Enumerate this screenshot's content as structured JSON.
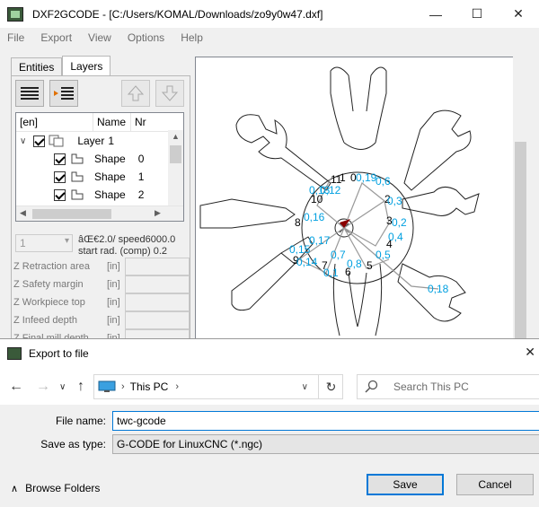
{
  "app": {
    "title": "DXF2GCODE - [C:/Users/KOMAL/Downloads/zo9y0w47.dxf]",
    "window_controls": [
      "—",
      "☐",
      "✕"
    ]
  },
  "menu": [
    "File",
    "Export",
    "View",
    "Options",
    "Help"
  ],
  "tabs": [
    "Entities",
    "Layers"
  ],
  "active_tab": "Layers",
  "tree": {
    "columns": [
      "[en]",
      "Name",
      "Nr"
    ],
    "rows": [
      {
        "name": "Layer",
        "nr": "1",
        "level": 0
      },
      {
        "name": "Shape",
        "nr": "0",
        "level": 1
      },
      {
        "name": "Shape",
        "nr": "1",
        "level": 1
      },
      {
        "name": "Shape",
        "nr": "2",
        "level": 1
      }
    ]
  },
  "tool_combo": "1",
  "speed_text_line1": "âŒ€2.0/ speed6000.0",
  "speed_text_line2": "start rad. (comp) 0.2",
  "params": [
    {
      "label": "Z Retraction area",
      "unit": "[in]"
    },
    {
      "label": "Z Safety margin",
      "unit": "[in]"
    },
    {
      "label": "Z Workpiece top",
      "unit": "[in]"
    },
    {
      "label": "Z Infeed depth",
      "unit": "[in]"
    },
    {
      "label": "Z Final mill depth",
      "unit": "[in]"
    }
  ],
  "canvas_labels": [
    "10",
    "11",
    "0",
    "1",
    "6",
    "2",
    "3",
    "4",
    "5",
    "7",
    "8",
    "9"
  ],
  "canvas_path_labels": [
    "0,6",
    "0,3",
    "0,2",
    "0,4",
    "0,5",
    "0,8",
    "0,7",
    "0,1",
    "0,17",
    "0,16",
    "0,15",
    "0,18",
    "0,13",
    "0,14",
    "0,12",
    "0,19"
  ],
  "dialog": {
    "title": "Export to file",
    "close": "✕",
    "address": [
      "This PC"
    ],
    "search_placeholder": "Search This PC",
    "file_name_label": "File name:",
    "file_name_value": "twc-gcode",
    "save_type_label": "Save as type:",
    "save_type_value": "G-CODE for LinuxCNC (*.ngc)",
    "browse_folders": "Browse Folders",
    "save": "Save",
    "cancel": "Cancel"
  },
  "colors": {
    "accent": "#0078d7",
    "path_label": "#00a0e0",
    "arrow": "#8b0000"
  }
}
